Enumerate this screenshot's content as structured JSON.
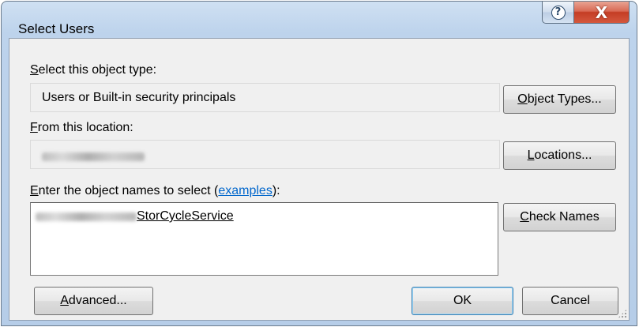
{
  "window": {
    "title": "Select Users",
    "help_glyph": "?",
    "close_glyph": "X"
  },
  "object_type": {
    "label_mnemonic": "S",
    "label_rest": "elect this object type:",
    "value": "Users or Built-in security principals",
    "button_mnemonic": "O",
    "button_rest": "bject Types..."
  },
  "location": {
    "label_mnemonic": "F",
    "label_rest": "rom this location:",
    "value_redacted": true,
    "button_mnemonic": "L",
    "button_rest": "ocations..."
  },
  "names": {
    "label_mnemonic": "E",
    "label_rest": "nter the object names to select (",
    "label_link": "examples",
    "label_end": "):",
    "resolved_name": "StorCycleService",
    "prefix_redacted": true,
    "check_mnemonic": "C",
    "check_rest": "heck Names"
  },
  "footer": {
    "advanced_mnemonic": "A",
    "advanced_rest": "dvanced...",
    "ok_label": "OK",
    "cancel_label": "Cancel"
  },
  "icons": {
    "help": "help-icon",
    "close": "close-icon",
    "grip": "resize-grip-icon"
  },
  "colors": {
    "link": "#0066cc",
    "close_button": "#c43d24",
    "default_button_border": "#3c7fb1"
  }
}
